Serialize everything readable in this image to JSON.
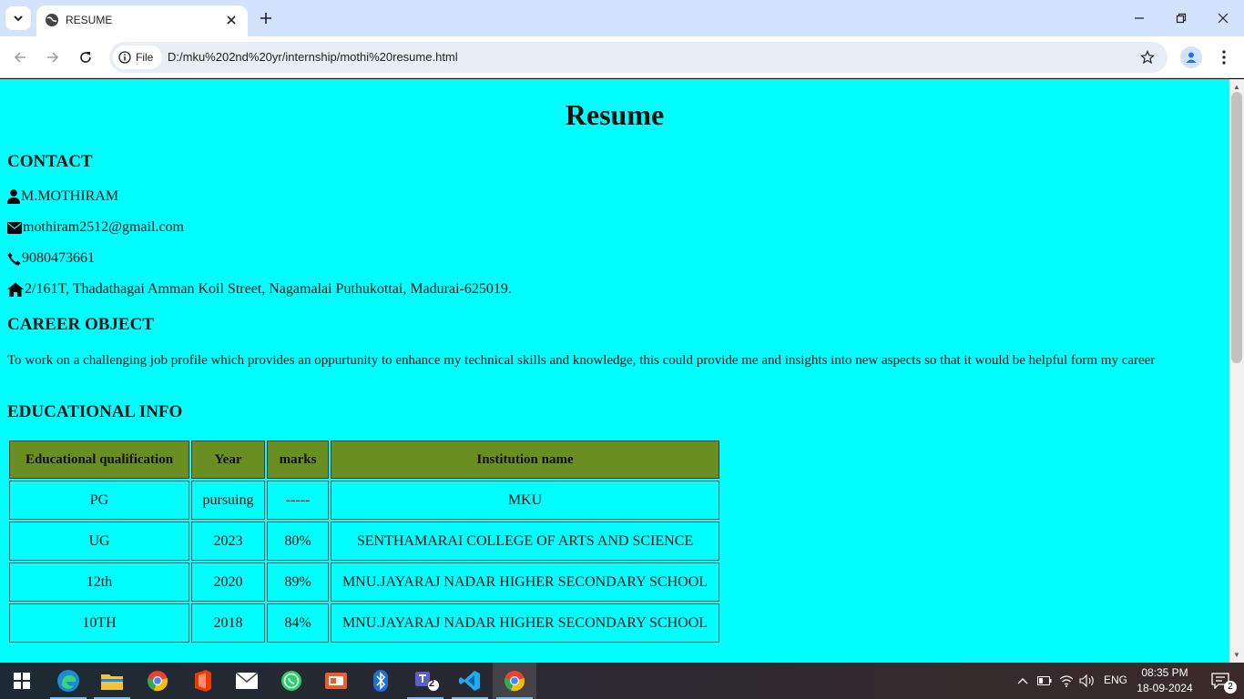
{
  "browser": {
    "tab_title": "RESUME",
    "omnibox": {
      "chip_label": "File",
      "url": "D:/mku%202nd%20yr/internship/mothi%20resume.html"
    }
  },
  "page": {
    "title": "Resume",
    "contact": {
      "heading": "CONTACT",
      "name": "M.MOTHIRAM",
      "email": "mothiram2512@gmail.com",
      "phone": "9080473661",
      "address": "2/161T, Thadathagai Amman Koil Street, Nagamalai Puthukottai, Madurai-625019."
    },
    "career": {
      "heading": "CAREER OBJECT",
      "text": "To work on a challenging job profile which provides an oppurtunity to enhance my technical skills and knowledge, this could provide me and insights into new aspects so that it would be helpful form my career"
    },
    "education": {
      "heading": "EDUCATIONAL INFO",
      "columns": [
        "Educational qualification",
        "Year",
        "marks",
        "Institution name"
      ],
      "rows": [
        [
          "PG",
          "pursuing",
          "-----",
          "MKU"
        ],
        [
          "UG",
          "2023",
          "80%",
          "SENTHAMARAI COLLEGE OF ARTS AND SCIENCE"
        ],
        [
          "12th",
          "2020",
          "89%",
          "MNU.JAYARAJ NADAR HIGHER SECONDARY SCHOOL"
        ],
        [
          "10TH",
          "2018",
          "84%",
          "MNU.JAYARAJ NADAR HIGHER SECONDARY SCHOOL"
        ]
      ]
    },
    "background_color": "#00ffff",
    "table_header_color": "#6b8e23"
  },
  "taskbar": {
    "apps": [
      "start-icon",
      "edge-icon",
      "file-explorer-icon",
      "chrome-icon",
      "office-icon",
      "mail-icon",
      "whatsapp-icon",
      "presentation-icon",
      "bluetooth-icon",
      "teams-icon",
      "vscode-icon",
      "chrome-icon"
    ],
    "teams_badge": "2",
    "language": "ENG",
    "time": "08:35 PM",
    "date": "18-09-2024",
    "notification_count": "2"
  }
}
